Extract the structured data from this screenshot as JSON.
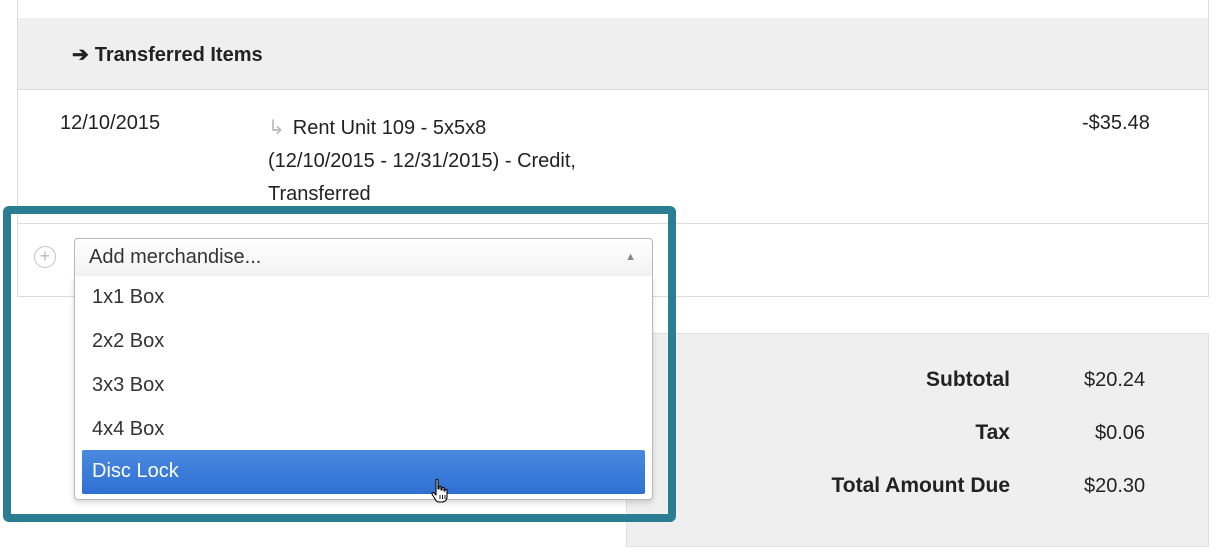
{
  "section": {
    "arrow": "➔",
    "title": "Transferred Items"
  },
  "item": {
    "date": "12/10/2015",
    "hook": "↳",
    "description_line1": "Rent Unit 109 - 5x5x8",
    "description_line2": "(12/10/2015 - 12/31/2015) - Credit,",
    "description_line3": "Transferred",
    "amount": "-$35.48"
  },
  "merchandise": {
    "plus": "+",
    "placeholder": "Add merchandise...",
    "caret": "▲",
    "options": [
      "1x1 Box",
      "2x2 Box",
      "3x3 Box",
      "4x4 Box",
      "Disc Lock"
    ],
    "selected_index": 4
  },
  "totals": {
    "subtotal_label": "Subtotal",
    "subtotal_value": "$20.24",
    "tax_label": "Tax",
    "tax_value": "$0.06",
    "total_label": "Total Amount Due",
    "total_value": "$20.30"
  },
  "colors": {
    "highlight_frame": "#2a7d93",
    "selected_option": "#3a7bd9",
    "header_bg": "#efefef"
  }
}
